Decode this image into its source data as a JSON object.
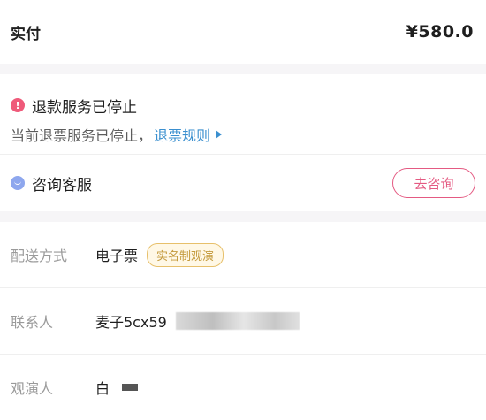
{
  "payment": {
    "label": "实付",
    "amount": "¥580.0"
  },
  "refund": {
    "title": "退款服务已停止",
    "description": "当前退票服务已停止，",
    "rules_link": "退票规则",
    "icon": "warning-circle-icon",
    "accent": "#ef5a7a"
  },
  "consult": {
    "label": "咨询客服",
    "button": "去咨询",
    "icon": "chat-bubble-icon",
    "accent": "#e45a82"
  },
  "info": {
    "delivery": {
      "label": "配送方式",
      "value": "电子票",
      "tag": "实名制观演"
    },
    "contact": {
      "label": "联系人",
      "value": "麦子5cx59"
    },
    "viewer": {
      "label": "观演人",
      "value": "白"
    }
  }
}
